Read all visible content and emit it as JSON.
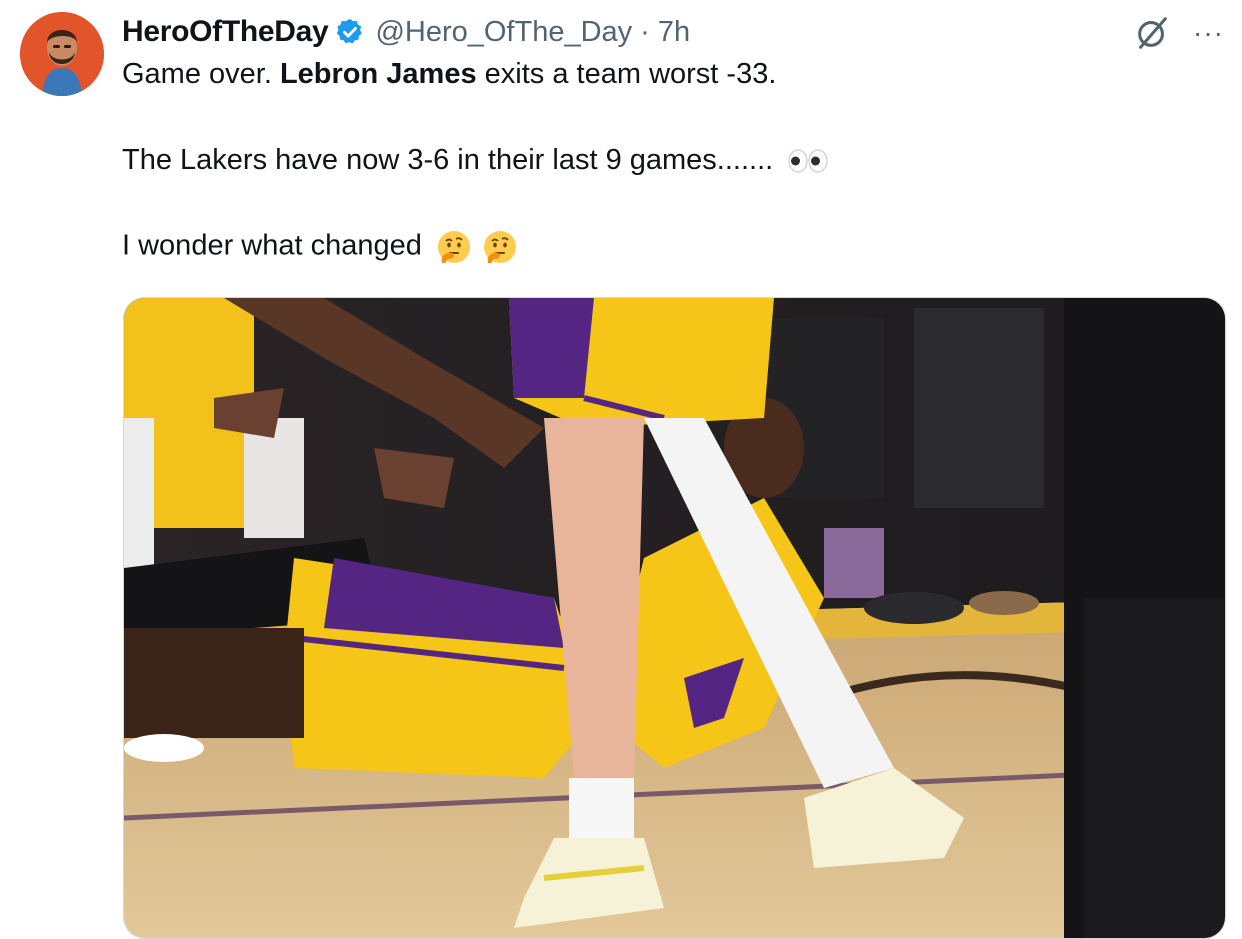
{
  "tweet": {
    "author": {
      "display_name": "HeroOfTheDay",
      "handle": "@Hero_OfThe_Day",
      "separator": "·",
      "time": "7h",
      "verified": true,
      "avatar_icon": "avatar-portrait"
    },
    "text": {
      "line1_pre": "Game over. ",
      "line1_bold": "Lebron James",
      "line1_post": " exits a team worst -33.",
      "line2": "The Lakers have now 3-6 in their last 9 games.......",
      "line2_emoji": "eyes",
      "line3": "I wonder what changed",
      "line3_emoji": [
        "thinking-face",
        "thinking-face"
      ]
    },
    "actions": {
      "grok_icon": "grok-icon",
      "more_icon": "more-icon",
      "more_glyph": "···"
    },
    "media": {
      "type": "photo",
      "description_icon": "basketball-court-photo"
    }
  },
  "colors": {
    "text": "#0f1419",
    "secondary": "#536471",
    "verified": "#1d9bf0",
    "lakers_gold": "#f5c518",
    "lakers_purple": "#552583"
  }
}
